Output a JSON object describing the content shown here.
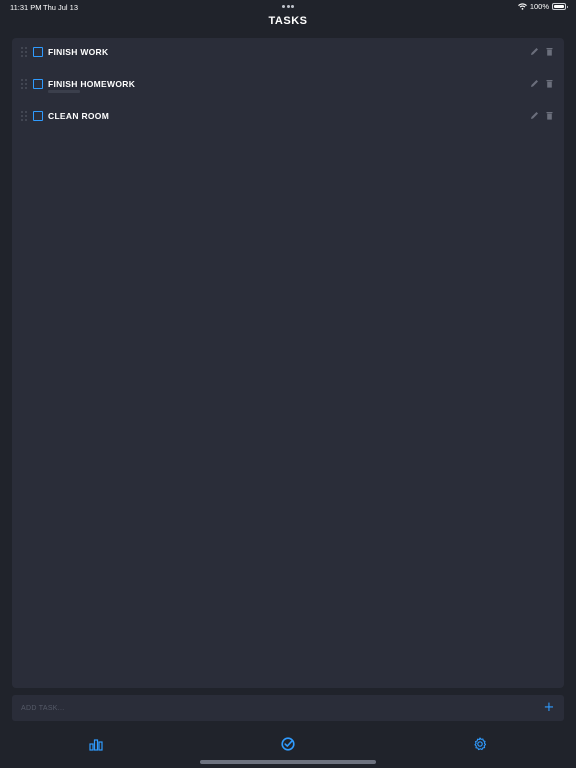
{
  "status_bar": {
    "time": "11:31 PM",
    "date": "Thu Jul 13",
    "battery": "100%"
  },
  "header": {
    "title": "TASKS"
  },
  "tasks": [
    {
      "label": "FINISH WORK",
      "checked": false
    },
    {
      "label": "FINISH HOMEWORK",
      "checked": false
    },
    {
      "label": "CLEAN ROOM",
      "checked": false
    }
  ],
  "add_task": {
    "placeholder": "ADD TASK...",
    "icon": "plus-icon"
  },
  "tab_bar": {
    "items": [
      {
        "icon": "stats-icon",
        "active": false
      },
      {
        "icon": "check-circle-icon",
        "active": true
      },
      {
        "icon": "gear-icon",
        "active": false
      }
    ]
  },
  "colors": {
    "background": "#20232b",
    "panel": "#2a2d39",
    "accent": "#2f9bff",
    "muted_icon": "#6b6f7c"
  }
}
